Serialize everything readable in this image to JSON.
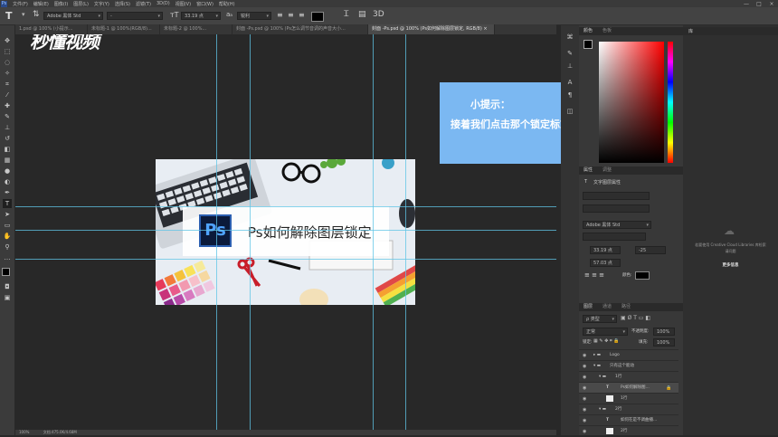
{
  "menubar": {
    "items": [
      "文件(F)",
      "编辑(E)",
      "图像(I)",
      "图层(L)",
      "文字(Y)",
      "选择(S)",
      "滤镜(T)",
      "3D(D)",
      "视图(V)",
      "窗口(W)",
      "帮助(H)"
    ],
    "logo": "Ps",
    "window_controls": [
      "—",
      "□",
      "×"
    ]
  },
  "watermark": "秒懂视频",
  "options": {
    "font_family": "Adobe 黑体 Std",
    "font_style": "-",
    "font_size": "33.19 点",
    "antialias": "锐利",
    "text_color": "#000000"
  },
  "tabs": [
    {
      "label": "1.psd @ 100% (小提示..."
    },
    {
      "label": "未标题-1 @ 100%(RGB/8)..."
    },
    {
      "label": "未标题-2 @ 100%..."
    },
    {
      "label": "封面 -Ps.psd @ 100% (Ps怎么调节音调的声音大小..."
    },
    {
      "label": "封面 -Ps.psd @ 100% (Ps如何解除图层锁定, RGB/8) ×"
    }
  ],
  "canvas": {
    "document_title": "Ps如何解除图层锁定",
    "ps_badge": "Ps"
  },
  "status": {
    "zoom": "100%",
    "doc_info": "文档:475.0K/4.68M"
  },
  "tip": {
    "title": "小提示：",
    "body": "接着我们点击那个锁定标志"
  },
  "color_panel": {
    "tabs": [
      "颜色",
      "色板"
    ]
  },
  "properties_panel": {
    "tabs": [
      "属性",
      "调整"
    ],
    "section_title": "文字图层属性",
    "font_family": "Adobe 黑体 Std",
    "font_size": "33.19 点",
    "tracking": "-25",
    "leading": "57.03 点",
    "color_label": "颜色:"
  },
  "layers_panel": {
    "tabs": [
      "图层",
      "通道",
      "路径"
    ],
    "filter": "ρ 类型",
    "blend_mode": "正常",
    "opacity_label": "不透明度:",
    "opacity": "100%",
    "lock_label": "锁定:",
    "fill_label": "填充:",
    "fill": "100%",
    "layers": [
      {
        "name": "Logo",
        "type": "folder",
        "indent": 0
      },
      {
        "name": "只有这个能动",
        "type": "folder",
        "indent": 0
      },
      {
        "name": "1行",
        "type": "folder",
        "indent": 1
      },
      {
        "name": "Ps如何解除图...",
        "type": "text",
        "indent": 2
      },
      {
        "name": "1行",
        "type": "layer",
        "indent": 2
      },
      {
        "name": "2行",
        "type": "folder",
        "indent": 1
      },
      {
        "name": "如何在是不调曲播...",
        "type": "text",
        "indent": 2
      },
      {
        "name": "2行",
        "type": "layer",
        "indent": 2
      }
    ]
  },
  "libraries_panel": {
    "tab": "库",
    "message_line1": "若要使用 Creative Cloud Libraries 库检索",
    "message_line2": "请问题",
    "link": "更多信息"
  },
  "colors": {
    "accent": "#5fc4e6",
    "tip_bg": "#7bb8f2",
    "ps_badge": "#2c5fb0"
  }
}
